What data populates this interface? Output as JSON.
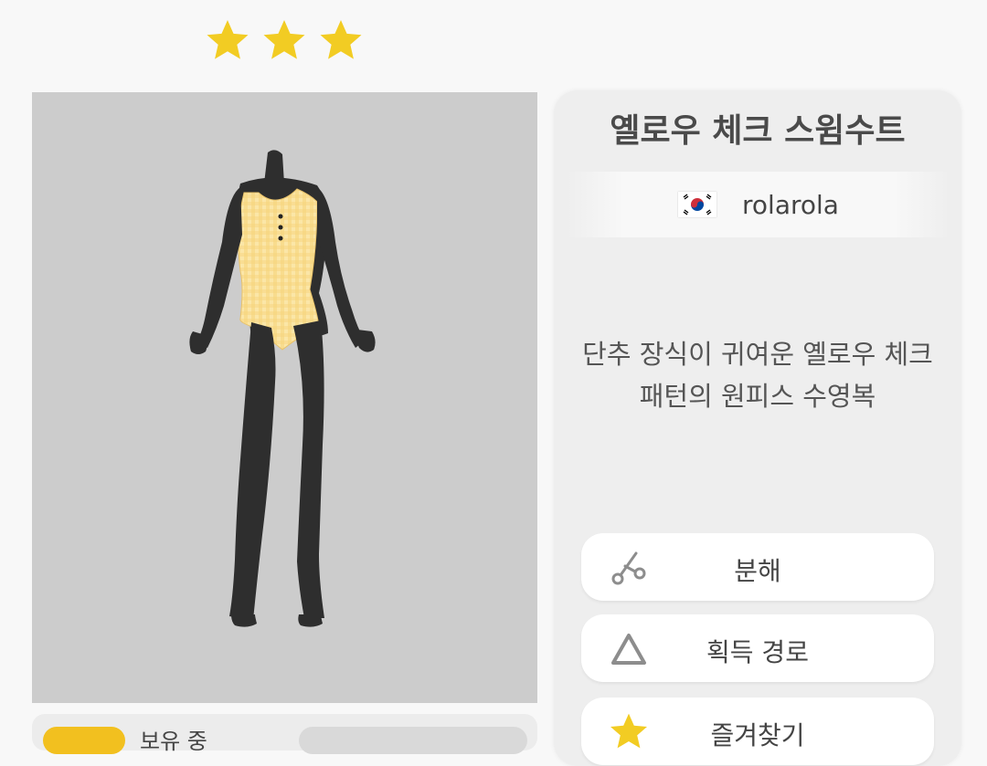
{
  "rating": {
    "stars": 3,
    "icon": "star-icon",
    "color": "#f2cc23"
  },
  "item": {
    "title": "옐로우 체크 스윔수트",
    "creator": {
      "flag": "korea-flag-icon",
      "name": "rolarola"
    },
    "description_lines": [
      "단추 장식이 귀여운 옐로우 체크",
      "패턴의 원피스 수영복"
    ]
  },
  "preview": {
    "background": "#cccccc"
  },
  "owned": {
    "label": "보유 중"
  },
  "actions": [
    {
      "label": "분해",
      "icon": "scissors-icon"
    },
    {
      "label": "획득 경로",
      "icon": "triangle-icon"
    },
    {
      "label": "즐겨찾기",
      "icon": "star-icon"
    }
  ]
}
